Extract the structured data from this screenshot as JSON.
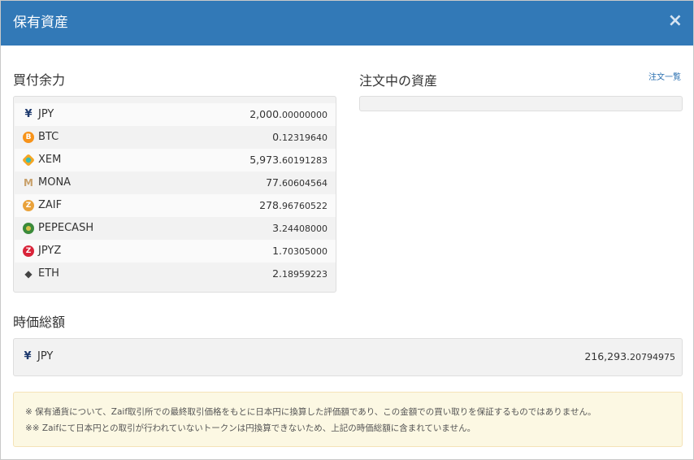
{
  "header": {
    "title": "保有資産",
    "close_label": "×"
  },
  "balance": {
    "title": "買付余力",
    "rows": [
      {
        "icon": "yen-icon",
        "symbol": "JPY",
        "int": "2,000.",
        "dec": "00000000"
      },
      {
        "icon": "bitcoin-icon",
        "symbol": "BTC",
        "int": "0.",
        "dec": "12319640"
      },
      {
        "icon": "xem-icon",
        "symbol": "XEM",
        "int": "5,973.",
        "dec": "60191283"
      },
      {
        "icon": "mona-icon",
        "symbol": "MONA",
        "int": "77.",
        "dec": "60604564"
      },
      {
        "icon": "zaif-icon",
        "symbol": "ZAIF",
        "int": "278.",
        "dec": "96760522"
      },
      {
        "icon": "pepecash-icon",
        "symbol": "PEPECASH",
        "int": "3.",
        "dec": "24408000"
      },
      {
        "icon": "jpyz-icon",
        "symbol": "JPYZ",
        "int": "1.",
        "dec": "70305000"
      },
      {
        "icon": "ethereum-icon",
        "symbol": "ETH",
        "int": "2.",
        "dec": "18959223"
      }
    ]
  },
  "orders": {
    "title": "注文中の資産",
    "link_label": "注文一覧"
  },
  "total": {
    "title": "時価総額",
    "symbol": "JPY",
    "int": "216,293.",
    "dec": "20794975"
  },
  "notice": {
    "line1": "※ 保有通貨について、Zaif取引所での最終取引価格をもとに日本円に換算した評価額であり、この金額での買い取りを保証するものではありません。",
    "line2": "※※ Zaifにて日本円との取引が行われていないトークンは円換算できないため、上記の時価総額に含まれていません。"
  }
}
